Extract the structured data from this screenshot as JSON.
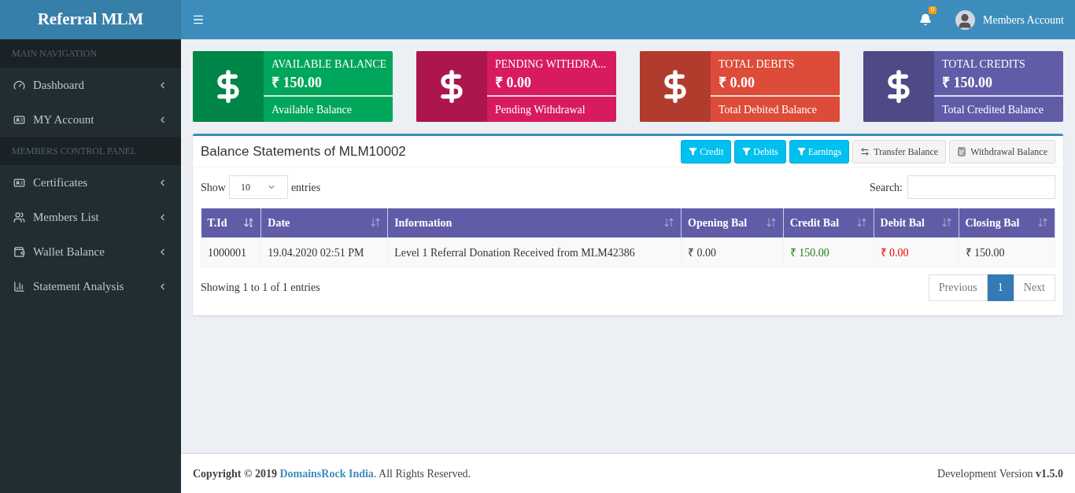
{
  "brand": "Referral MLM",
  "header": {
    "notification_count": "0",
    "user": "Members Account"
  },
  "sidebar": {
    "sections": [
      {
        "heading": "MAIN NAVIGATION",
        "items": [
          {
            "label": "Dashboard",
            "kind": "dashboard"
          },
          {
            "label": "MY Account",
            "kind": "account"
          }
        ]
      },
      {
        "heading": "MEMBERS CONTROL PANEL",
        "items": [
          {
            "label": "Certificates",
            "kind": "certificates"
          },
          {
            "label": "Members List",
            "kind": "members"
          },
          {
            "label": "Wallet Balance",
            "kind": "wallet"
          },
          {
            "label": "Statement Analysis",
            "kind": "statement"
          }
        ]
      }
    ]
  },
  "info_boxes": [
    {
      "title": "AVAILABLE BALANCE",
      "amount": "₹ 150.00",
      "caption": "Available Balance",
      "color": "#00a65a"
    },
    {
      "title": "PENDING WITHDRA...",
      "amount": "₹ 0.00",
      "caption": "Pending Withdrawal",
      "color": "#d81b60"
    },
    {
      "title": "TOTAL DEBITS",
      "amount": "₹ 0.00",
      "caption": "Total Debited Balance",
      "color": "#dd4b39"
    },
    {
      "title": "TOTAL CREDITS",
      "amount": "₹ 150.00",
      "caption": "Total Credited Balance",
      "color": "#605ca8"
    }
  ],
  "panel": {
    "title": "Balance Statements of MLM10002",
    "buttons": [
      {
        "label": "Credit",
        "kind": "filter"
      },
      {
        "label": "Debits",
        "kind": "filter"
      },
      {
        "label": "Earnings",
        "kind": "filter"
      },
      {
        "label": "Transfer Balance",
        "kind": "transfer"
      },
      {
        "label": "Withdrawal Balance",
        "kind": "calculator"
      }
    ],
    "show_label": "Show",
    "page_size": "10",
    "entries_label": "entries",
    "search_label": "Search:",
    "table": {
      "columns": [
        {
          "label": "T.Id",
          "sorted": true
        },
        {
          "label": "Date",
          "sorted": false
        },
        {
          "label": "Information",
          "sorted": false
        },
        {
          "label": "Opening Bal",
          "sorted": false
        },
        {
          "label": "Credit Bal",
          "sorted": false
        },
        {
          "label": "Debit Bal",
          "sorted": false
        },
        {
          "label": "Closing Bal",
          "sorted": false
        }
      ],
      "rows": [
        [
          {
            "text": "1000001",
            "color": "#333333"
          },
          {
            "text": "19.04.2020 02:51 PM",
            "color": "#333333"
          },
          {
            "text": "Level 1 Referral Donation Received from MLM42386",
            "color": "#333333"
          },
          {
            "text": "₹ 0.00",
            "color": "#333333"
          },
          {
            "text": "₹ 150.00",
            "color": "#1e7e1e"
          },
          {
            "text": "₹ 0.00",
            "color": "#ee0000"
          },
          {
            "text": "₹ 150.00",
            "color": "#333333"
          }
        ]
      ]
    },
    "info": "Showing 1 to 1 of 1 entries",
    "pagination": [
      {
        "label": "Previous",
        "selected": false
      },
      {
        "label": "1",
        "selected": true
      },
      {
        "label": "Next",
        "selected": false
      }
    ]
  },
  "footer": {
    "copyright": "**Copyright © 2019**",
    "link": "DomainsRock India",
    "suffix": ". All Rights Reserved.",
    "version": "Development Version **v1.5.0**"
  }
}
